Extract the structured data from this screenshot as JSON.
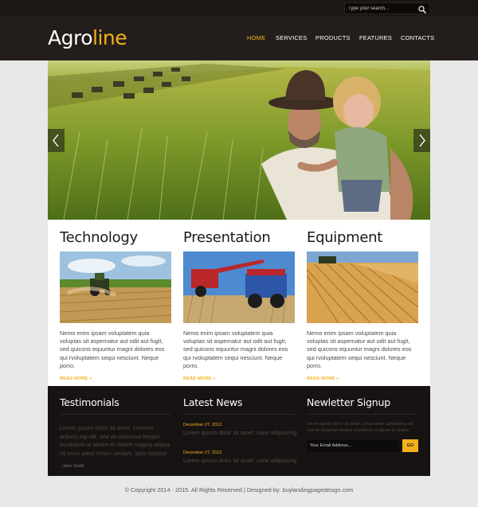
{
  "search": {
    "placeholder": "Type your search..."
  },
  "logo": {
    "part1": "Agro",
    "part2": "line"
  },
  "nav": [
    {
      "label": "HOME",
      "active": true
    },
    {
      "label": "SERVICES",
      "active": false
    },
    {
      "label": "PRODUCTS",
      "active": false
    },
    {
      "label": "FEATURES",
      "active": false
    },
    {
      "label": "CONTACTS",
      "active": false
    }
  ],
  "hero": {
    "prev_icon": "chevron-left-icon",
    "next_icon": "chevron-right-icon"
  },
  "features": [
    {
      "title": "Technology",
      "text": "Nemo enim ipsam voluptatem quia voluptas sit aspernatur aut odit aut fugit, sed quicons equuntur magni dolores eos qui rvoluptatem sequi nesciunt. Neque porro.",
      "more": "READ MORE »"
    },
    {
      "title": "Presentation",
      "text": "Nemo enim ipsam voluptatem quia voluptas sit aspernatur aut odit aut fugit, sed quicons equuntur magni dolores eos qui rvoluptatem sequi nesciunt. Neque porro.",
      "more": "READ MORE »"
    },
    {
      "title": "Equipment",
      "text": "Nemo enim ipsam voluptatem quia voluptas sit aspernatur aut odit aut fugit, sed quicons equuntur magni dolores eos qui rvoluptatem sequi nesciunt. Neque porro.",
      "more": "READ MORE »"
    }
  ],
  "testimonials": {
    "title": "Testimonials",
    "quote": "Lorem ipsum dolor sit amet, consect adipisc ing elit, sed do eiusmod tempor incididunt ut labore et dolore magna aliqua. Ut enim aded minim veniam, quis nostrud",
    "author": "- John Smith"
  },
  "news": {
    "title": "Latest News",
    "items": [
      {
        "date": "December 27, 2012",
        "text": "Lorem ipsum dolor sit amet, cone adipiscing"
      },
      {
        "date": "December 27, 2012",
        "text": "Lorem ipsum dolor sit amet, cone adipiscing"
      }
    ]
  },
  "newsletter": {
    "title": "Newletter Signup",
    "text": "Lorem ipsum dolor sit amet, consectetur adipisicing elit, sed do eiusmod tempor incididunt ut labore et dolore",
    "placeholder": "Your Email Address...",
    "button": "GO"
  },
  "footer": {
    "text": "© Copyright 2014 - 2015. All Rights Reserved | Designed by: buylandingpagedesign.com"
  },
  "colors": {
    "accent": "#f5b11b",
    "dark": "#161312",
    "header": "#231e1b"
  }
}
